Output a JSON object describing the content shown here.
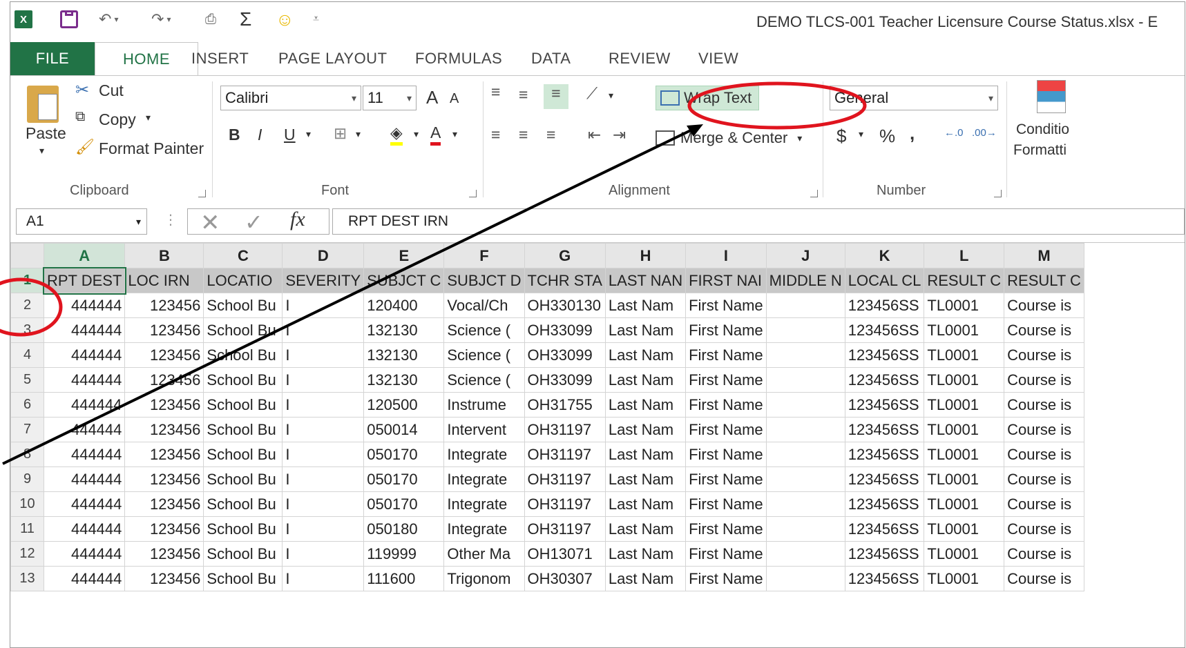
{
  "window": {
    "title": "DEMO TLCS-001 Teacher Licensure Course Status.xlsx - E",
    "app_icon_text": "X"
  },
  "tabs": [
    "FILE",
    "HOME",
    "INSERT",
    "PAGE LAYOUT",
    "FORMULAS",
    "DATA",
    "REVIEW",
    "VIEW"
  ],
  "ribbon": {
    "clipboard": {
      "paste": "Paste",
      "cut": "Cut",
      "copy": "Copy",
      "format_painter": "Format Painter",
      "label": "Clipboard"
    },
    "font": {
      "name": "Calibri",
      "size": "11",
      "grow": "A",
      "shrink": "A",
      "bold": "B",
      "italic": "I",
      "underline": "U",
      "font_color_glyph": "A",
      "label": "Font"
    },
    "alignment": {
      "wrap_text": "Wrap Text",
      "merge_center": "Merge & Center",
      "label": "Alignment"
    },
    "number": {
      "format": "General",
      "currency": "$",
      "percent": "%",
      "comma": ",",
      "label": "Number"
    },
    "styles": {
      "conditional_line1": "Conditio",
      "conditional_line2": "Formatti"
    }
  },
  "formula_bar": {
    "name_box": "A1",
    "fx": "fx",
    "content": "RPT DEST IRN"
  },
  "sheet": {
    "columns": [
      "A",
      "B",
      "C",
      "D",
      "E",
      "F",
      "G",
      "H",
      "I",
      "J",
      "K",
      "L",
      "M"
    ],
    "header_row": [
      "RPT DEST",
      "LOC IRN",
      "LOCATIO",
      "SEVERITY",
      "SUBJCT C",
      "SUBJCT D",
      "TCHR STA",
      "LAST NAN",
      "FIRST NAI",
      "MIDDLE N",
      "LOCAL CL",
      "RESULT C",
      "RESULT C"
    ],
    "rows": [
      {
        "num": "2",
        "cells": [
          "444444",
          "123456",
          "School Bu",
          "I",
          "120400",
          "Vocal/Ch",
          "OH330130",
          "Last Nam",
          "First Name",
          "",
          "123456SS",
          "TL0001",
          "Course is"
        ]
      },
      {
        "num": "3",
        "cells": [
          "444444",
          "123456",
          "School Bu",
          "I",
          "132130",
          "Science (",
          "OH33099",
          "Last Nam",
          "First Name",
          "",
          "123456SS",
          "TL0001",
          "Course is"
        ]
      },
      {
        "num": "4",
        "cells": [
          "444444",
          "123456",
          "School Bu",
          "I",
          "132130",
          "Science (",
          "OH33099",
          "Last Nam",
          "First Name",
          "",
          "123456SS",
          "TL0001",
          "Course is"
        ]
      },
      {
        "num": "5",
        "cells": [
          "444444",
          "123456",
          "School Bu",
          "I",
          "132130",
          "Science (",
          "OH33099",
          "Last Nam",
          "First Name",
          "",
          "123456SS",
          "TL0001",
          "Course is"
        ]
      },
      {
        "num": "6",
        "cells": [
          "444444",
          "123456",
          "School Bu",
          "I",
          "120500",
          "Instrume",
          "OH31755",
          "Last Nam",
          "First Name",
          "",
          "123456SS",
          "TL0001",
          "Course is"
        ]
      },
      {
        "num": "7",
        "cells": [
          "444444",
          "123456",
          "School Bu",
          "I",
          "050014",
          "Intervent",
          "OH31197",
          "Last Nam",
          "First Name",
          "",
          "123456SS",
          "TL0001",
          "Course is"
        ]
      },
      {
        "num": "8",
        "cells": [
          "444444",
          "123456",
          "School Bu",
          "I",
          "050170",
          "Integrate",
          "OH31197",
          "Last Nam",
          "First Name",
          "",
          "123456SS",
          "TL0001",
          "Course is"
        ]
      },
      {
        "num": "9",
        "cells": [
          "444444",
          "123456",
          "School Bu",
          "I",
          "050170",
          "Integrate",
          "OH31197",
          "Last Nam",
          "First Name",
          "",
          "123456SS",
          "TL0001",
          "Course is"
        ]
      },
      {
        "num": "10",
        "cells": [
          "444444",
          "123456",
          "School Bu",
          "I",
          "050170",
          "Integrate",
          "OH31197",
          "Last Nam",
          "First Name",
          "",
          "123456SS",
          "TL0001",
          "Course is"
        ]
      },
      {
        "num": "11",
        "cells": [
          "444444",
          "123456",
          "School Bu",
          "I",
          "050180",
          "Integrate",
          "OH31197",
          "Last Nam",
          "First Name",
          "",
          "123456SS",
          "TL0001",
          "Course is"
        ]
      },
      {
        "num": "12",
        "cells": [
          "444444",
          "123456",
          "School Bu",
          "I",
          "119999",
          "Other Ma",
          "OH13071",
          "Last Nam",
          "First Name",
          "",
          "123456SS",
          "TL0001",
          "Course is"
        ]
      },
      {
        "num": "13",
        "cells": [
          "444444",
          "123456",
          "School Bu",
          "I",
          "111600",
          "Trigonom",
          "OH30307",
          "Last Nam",
          "First Name",
          "",
          "123456SS",
          "TL0001",
          "Course is"
        ]
      }
    ]
  },
  "colors": {
    "excel_green": "#217346",
    "annotation_red": "#e0141e",
    "wrap_highlight": "#cfe8d6"
  }
}
